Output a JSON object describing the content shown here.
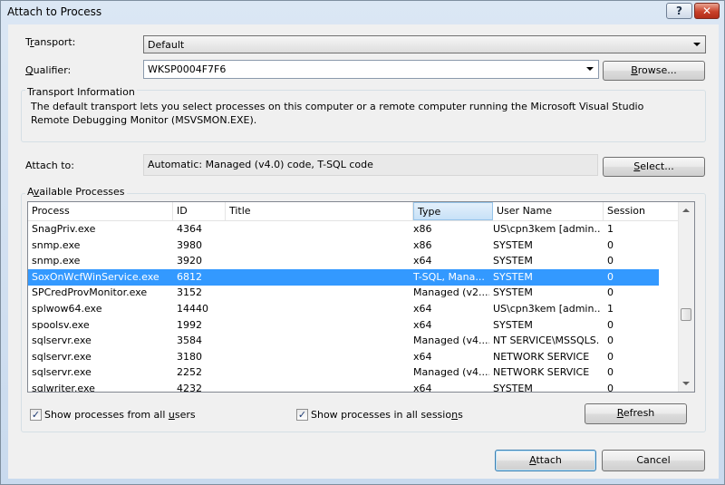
{
  "window": {
    "title": "Attach to Process",
    "help_glyph": "?",
    "close_glyph": "✕"
  },
  "transport": {
    "label_prefix": "T",
    "label_accel": "r",
    "label_rest": "ansport:",
    "value": "Default"
  },
  "qualifier": {
    "label_accel": "Q",
    "label_rest": "ualifier:",
    "value": "WKSP0004F7F6",
    "browse_accel": "B",
    "browse_rest": "rowse..."
  },
  "transport_info": {
    "title": "Transport Information",
    "text": "The default transport lets you select processes on this computer or a remote computer running the Microsoft Visual Studio Remote Debugging Monitor (MSVSMON.EXE)."
  },
  "attach_to": {
    "label": "Attach to:",
    "value": "Automatic: Managed (v4.0) code, T-SQL code",
    "select_accel": "S",
    "select_rest": "elect..."
  },
  "processes": {
    "group_prefix": "A",
    "group_accel": "v",
    "group_rest": "ailable Processes",
    "columns": [
      "Process",
      "ID",
      "Title",
      "Type",
      "User Name",
      "Session"
    ],
    "rows": [
      [
        "SnagPriv.exe",
        "4364",
        "",
        "x86",
        "US\\cpn3kem [admin...",
        "1"
      ],
      [
        "snmp.exe",
        "3980",
        "",
        "x86",
        "SYSTEM",
        "0"
      ],
      [
        "snmp.exe",
        "3920",
        "",
        "x64",
        "SYSTEM",
        "0"
      ],
      [
        "SoxOnWcfWinService.exe",
        "6812",
        "",
        "T-SQL, Mana...",
        "SYSTEM",
        "0"
      ],
      [
        "SPCredProvMonitor.exe",
        "3152",
        "",
        "Managed (v2....",
        "SYSTEM",
        "0"
      ],
      [
        "splwow64.exe",
        "14440",
        "",
        "x64",
        "US\\cpn3kem [admin...",
        "1"
      ],
      [
        "spoolsv.exe",
        "1992",
        "",
        "x64",
        "SYSTEM",
        "0"
      ],
      [
        "sqlservr.exe",
        "3584",
        "",
        "Managed (v4....",
        "NT SERVICE\\MSSQLS...",
        "0"
      ],
      [
        "sqlservr.exe",
        "3180",
        "",
        "x64",
        "NETWORK SERVICE",
        "0"
      ],
      [
        "sqlservr.exe",
        "2252",
        "",
        "Managed (v4....",
        "NETWORK SERVICE",
        "0"
      ],
      [
        "sqlwriter.exe",
        "4232",
        "",
        "x64",
        "SYSTEM",
        "0"
      ]
    ],
    "selected_index": 3
  },
  "options": {
    "all_users_prefix": "Show processes from all ",
    "all_users_accel": "u",
    "all_users_rest": "sers",
    "all_users_checked": true,
    "all_sessions_prefix": "Show processes in all sessio",
    "all_sessions_accel": "n",
    "all_sessions_rest": "s",
    "all_sessions_checked": true,
    "check_glyph": "✓",
    "refresh_accel": "R",
    "refresh_rest": "efresh"
  },
  "footer": {
    "attach_accel": "A",
    "attach_rest": "ttach",
    "cancel": "Cancel"
  },
  "icons": {
    "arrow_up": "scroll-up-icon",
    "arrow_down": "scroll-down-icon"
  }
}
